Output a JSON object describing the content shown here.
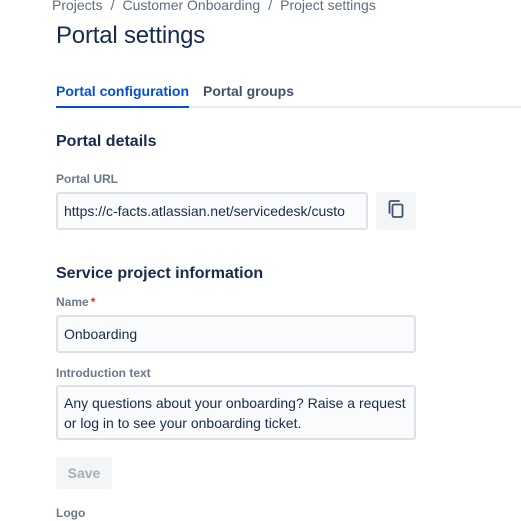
{
  "breadcrumb": {
    "items": [
      "Projects",
      "Customer Onboarding",
      "Project settings"
    ],
    "separator": "/"
  },
  "page": {
    "title": "Portal settings"
  },
  "tabs": [
    {
      "label": "Portal configuration",
      "active": true
    },
    {
      "label": "Portal groups",
      "active": false
    }
  ],
  "portal_details": {
    "heading": "Portal details",
    "url_label": "Portal URL",
    "url_value": "https://c-facts.atlassian.net/servicedesk/custo",
    "copy_icon": "copy-icon"
  },
  "service_info": {
    "heading": "Service project information",
    "name_label": "Name",
    "required_mark": "*",
    "name_value": "Onboarding",
    "intro_label": "Introduction text",
    "intro_value": "Any questions about your onboarding? Raise a request or log in to see your onboarding ticket.",
    "save_label": "Save"
  },
  "logo": {
    "label": "Logo"
  },
  "colors": {
    "accent": "#0052cc",
    "required": "#de350b",
    "text": "#172b4d",
    "subtle_text": "#6b778c"
  }
}
